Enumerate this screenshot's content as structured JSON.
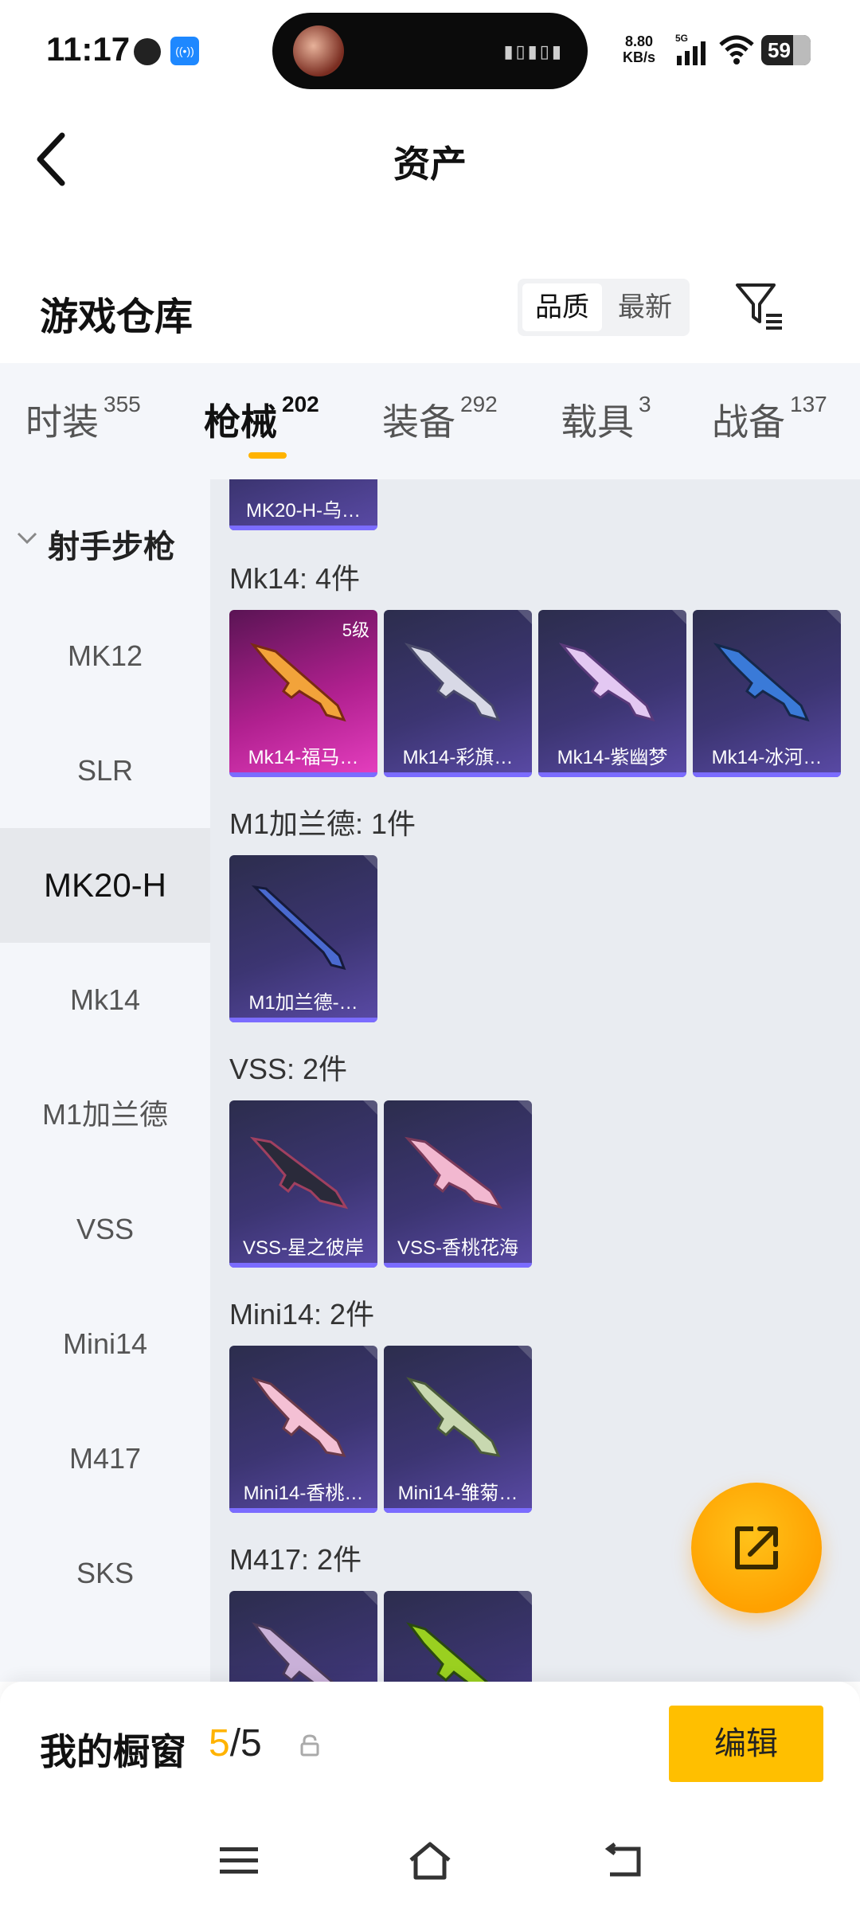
{
  "status_bar": {
    "time": "11:17",
    "speed_value": "8.80",
    "speed_unit": "KB/s",
    "network": "5G",
    "battery": "59"
  },
  "header": {
    "title": "资产"
  },
  "section": {
    "title": "游戏仓库",
    "sort_options": [
      "品质",
      "最新"
    ],
    "sort_selected": "品质"
  },
  "tabs": [
    {
      "label": "时装",
      "count": "355"
    },
    {
      "label": "枪械",
      "count": "202",
      "active": true
    },
    {
      "label": "装备",
      "count": "292"
    },
    {
      "label": "载具",
      "count": "3"
    },
    {
      "label": "战备",
      "count": "137"
    }
  ],
  "sidebar": {
    "group": "射手步枪",
    "items": [
      "MK12",
      "SLR",
      "MK20-H",
      "Mk14",
      "M1加兰德",
      "VSS",
      "Mini14",
      "M417",
      "SKS"
    ],
    "selected": "MK20-H"
  },
  "content": {
    "partial_top_card": "MK20-H-乌…",
    "groups": [
      {
        "title": "Mk14: 4件",
        "items": [
          {
            "name": "Mk14-福马…",
            "level": "5级",
            "tier": "gold"
          },
          {
            "name": "Mk14-彩旗…"
          },
          {
            "name": "Mk14-紫幽梦"
          },
          {
            "name": "Mk14-冰河…"
          }
        ]
      },
      {
        "title": "M1加兰德: 1件",
        "items": [
          {
            "name": "M1加兰德-…"
          }
        ]
      },
      {
        "title": "VSS: 2件",
        "items": [
          {
            "name": "VSS-星之彼岸"
          },
          {
            "name": "VSS-香桃花海"
          }
        ]
      },
      {
        "title": "Mini14: 2件",
        "items": [
          {
            "name": "Mini14-香桃…"
          },
          {
            "name": "Mini14-雏菊…"
          }
        ]
      },
      {
        "title": "M417: 2件",
        "items": [
          {
            "name": ""
          },
          {
            "name": ""
          }
        ]
      }
    ]
  },
  "bottom": {
    "title": "我的橱窗",
    "current": "5",
    "total": "/5",
    "edit_label": "编辑"
  },
  "colors": {
    "accent": "#ffb300",
    "card_purple": "#3c3572",
    "card_gold": "#b0208f",
    "background": "#e9ecf1"
  }
}
